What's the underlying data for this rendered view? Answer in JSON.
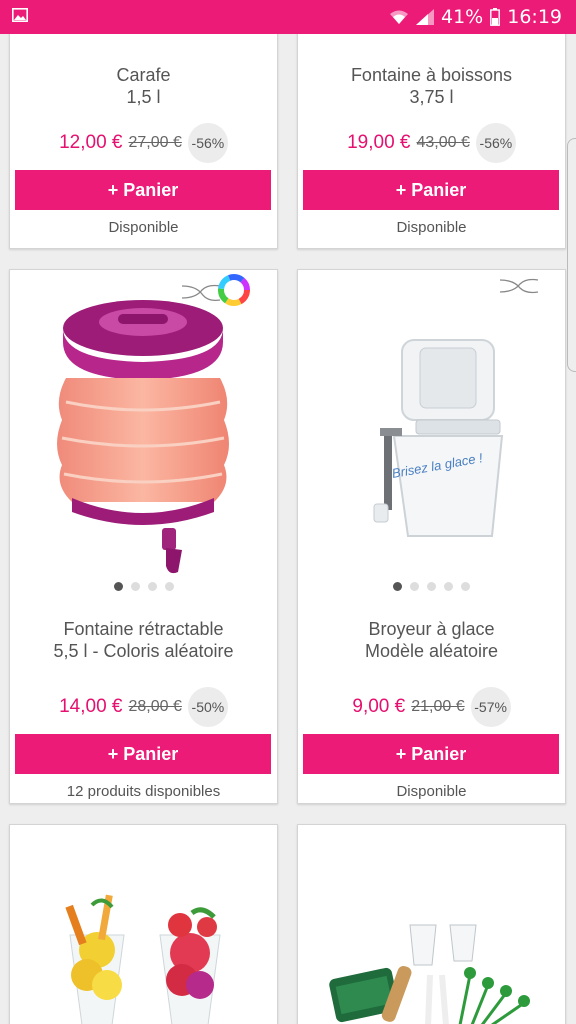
{
  "status_bar": {
    "battery": "41%",
    "time": "16:19"
  },
  "products": [
    {
      "title_line1": "Carafe",
      "title_line2": "1,5 l",
      "price": "12,00 €",
      "old_price": "27,00 €",
      "discount": "-56%",
      "button": "+ Panier",
      "availability": "Disponible"
    },
    {
      "title_line1": "Fontaine à boissons",
      "title_line2": "3,75 l",
      "price": "19,00 €",
      "old_price": "43,00 €",
      "discount": "-56%",
      "button": "+ Panier",
      "availability": "Disponible"
    },
    {
      "title_line1": "Fontaine rétractable",
      "title_line2": "5,5 l - Coloris aléatoire",
      "price": "14,00 €",
      "old_price": "28,00 €",
      "discount": "-50%",
      "button": "+ Panier",
      "availability": "12 produits disponibles"
    },
    {
      "title_line1": "Broyeur à glace",
      "title_line2": "Modèle aléatoire",
      "price": "9,00 €",
      "old_price": "21,00 €",
      "discount": "-57%",
      "button": "+ Panier",
      "availability": "Disponible",
      "image_text": "Brisez la glace !"
    }
  ],
  "colors": {
    "brand": "#ec1b78",
    "price": "#e5106f"
  },
  "icons": {
    "status_left": "image-icon",
    "wifi": "wifi-icon",
    "signal": "signal-icon",
    "battery": "battery-icon",
    "shuffle": "shuffle-icon",
    "color_wheel": "color-wheel-icon"
  }
}
